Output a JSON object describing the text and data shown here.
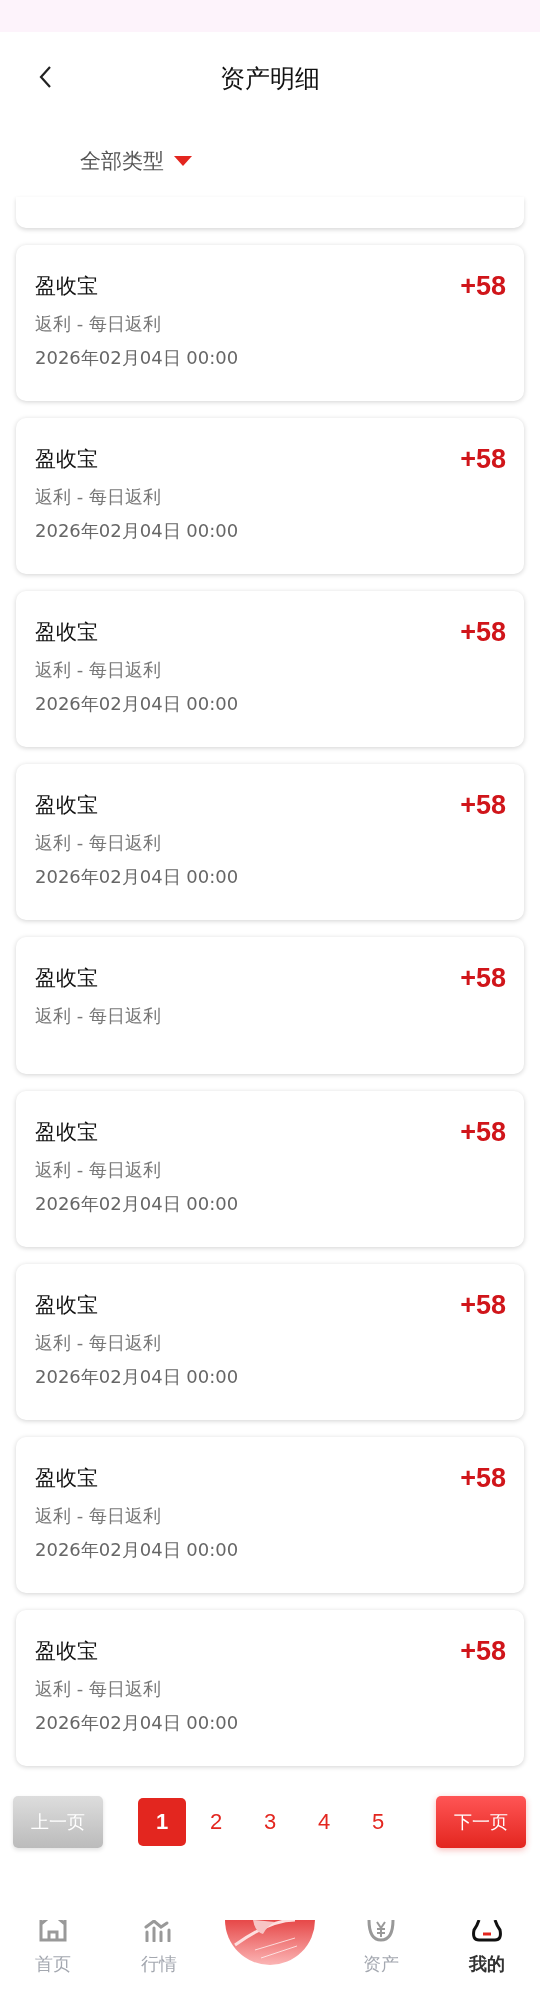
{
  "header": {
    "title": "资产明细"
  },
  "filter": {
    "label": "全部类型"
  },
  "records": [
    {
      "title": "盈收宝",
      "amount": "+58",
      "category": "返利 - 每日返利",
      "date": "2026年02月04日 00:00"
    },
    {
      "title": "盈收宝",
      "amount": "+58",
      "category": "返利 - 每日返利",
      "date": "2026年02月04日 00:00"
    },
    {
      "title": "盈收宝",
      "amount": "+58",
      "category": "返利 - 每日返利",
      "date": "2026年02月04日 00:00"
    },
    {
      "title": "盈收宝",
      "amount": "+58",
      "category": "返利 - 每日返利",
      "date": "2026年02月04日 00:00"
    },
    {
      "title": "盈收宝",
      "amount": "+58",
      "category": "返利 - 每日返利"
    },
    {
      "title": "盈收宝",
      "amount": "+58",
      "category": "返利 - 每日返利",
      "date": "2026年02月04日 00:00"
    },
    {
      "title": "盈收宝",
      "amount": "+58",
      "category": "返利 - 每日返利",
      "date": "2026年02月04日 00:00"
    },
    {
      "title": "盈收宝",
      "amount": "+58",
      "category": "返利 - 每日返利",
      "date": "2026年02月04日 00:00"
    },
    {
      "title": "盈收宝",
      "amount": "+58",
      "category": "返利 - 每日返利",
      "date": "2026年02月04日 00:00"
    }
  ],
  "pagination": {
    "prev": {
      "label": "上一页",
      "disabled": true
    },
    "pages": [
      {
        "label": "1",
        "selected": true
      },
      {
        "label": "2",
        "selected": false
      },
      {
        "label": "3",
        "selected": false
      },
      {
        "label": "4",
        "selected": false
      },
      {
        "label": "5",
        "selected": false
      }
    ],
    "next": {
      "label": "下一页",
      "disabled": false
    }
  },
  "tab_bar": [
    {
      "kind": "tab",
      "label": "首页",
      "selected": false
    },
    {
      "kind": "tab",
      "label": "行情",
      "selected": false
    },
    {
      "kind": "center"
    },
    {
      "kind": "tab",
      "label": "资产",
      "selected": false
    },
    {
      "kind": "tab",
      "label": "我的",
      "selected": true
    }
  ]
}
